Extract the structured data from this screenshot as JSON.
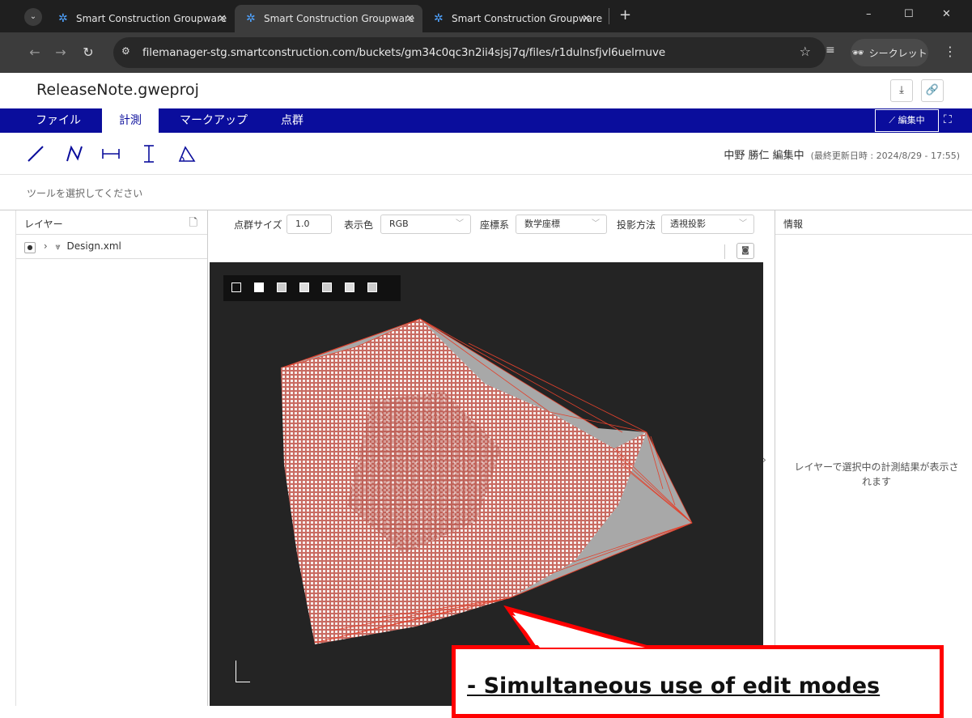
{
  "browser": {
    "tabs": [
      {
        "title": "Smart Construction Groupware",
        "active": false
      },
      {
        "title": "Smart Construction Groupware",
        "active": true
      },
      {
        "title": "Smart Construction Groupware",
        "active": false
      }
    ],
    "new_tab_symbol": "+",
    "url": "filemanager-stg.smartconstruction.com/buckets/gm34c0qc3n2ii4sjsj7q/files/r1dulnsfjvl6uelrnuve",
    "incognito_label": "シークレット",
    "window_controls": [
      "–",
      "☐",
      "✕"
    ]
  },
  "app": {
    "title": "ReleaseNote.gweproj",
    "menu": [
      "ファイル",
      "計測",
      "マークアップ",
      "点群"
    ],
    "active_menu": "計測",
    "edit_label": "編集中",
    "editor_name": "中野 勝仁 編集中",
    "last_updated": "(最終更新日時 : 2024/8/29 - 17:55)",
    "hint": "ツールを選択してください",
    "tool_icons": [
      "line-tool-icon",
      "polyline-tool-icon",
      "horizontal-distance-icon",
      "vertical-distance-icon",
      "angle-tool-icon"
    ]
  },
  "layers": {
    "header": "レイヤー",
    "items": [
      {
        "name": "Design.xml"
      }
    ]
  },
  "pointcloud_controls": {
    "size_label": "点群サイズ",
    "size_value": "1.0",
    "color_label": "表示色",
    "color_value": "RGB",
    "coord_label": "座標系",
    "coord_value": "数学座標",
    "projection_label": "投影方法",
    "projection_value": "透視投影"
  },
  "info": {
    "header": "情報",
    "message": "レイヤーで選択中の計測結果が表示されます"
  },
  "callout": {
    "text": "- Simultaneous use of edit modes",
    "border_color": "#ff0000"
  },
  "colors": {
    "menubar": "#0a0d9c",
    "viewport_bg": "#242424",
    "mesh_edges": "#e2412c"
  }
}
